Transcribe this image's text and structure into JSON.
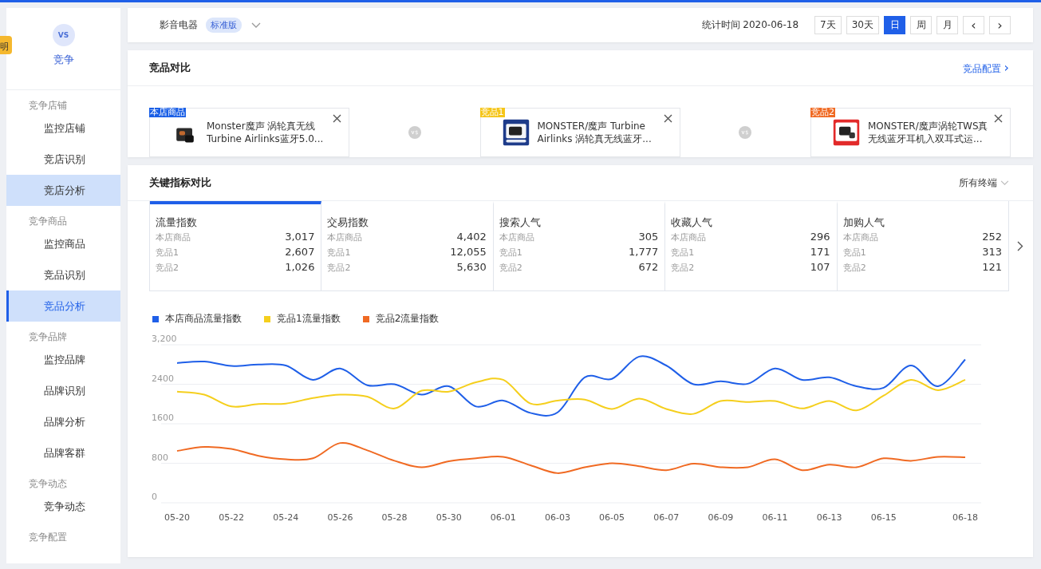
{
  "help_badge": {
    "label": "明"
  },
  "sidebar": {
    "header": {
      "label": "竞争",
      "icon_text": "VS"
    },
    "groups": [
      {
        "title": "竞争店铺",
        "items": [
          {
            "label": "监控店铺",
            "selected": false,
            "hovered": false
          },
          {
            "label": "竞店识别",
            "selected": false,
            "hovered": false
          },
          {
            "label": "竞店分析",
            "selected": false,
            "hovered": true
          }
        ]
      },
      {
        "title": "竞争商品",
        "items": [
          {
            "label": "监控商品",
            "selected": false,
            "hovered": false
          },
          {
            "label": "竞品识别",
            "selected": false,
            "hovered": false
          },
          {
            "label": "竞品分析",
            "selected": true,
            "hovered": false
          }
        ]
      },
      {
        "title": "竞争品牌",
        "items": [
          {
            "label": "监控品牌",
            "selected": false,
            "hovered": false
          },
          {
            "label": "品牌识别",
            "selected": false,
            "hovered": false
          },
          {
            "label": "品牌分析",
            "selected": false,
            "hovered": false
          },
          {
            "label": "品牌客群",
            "selected": false,
            "hovered": false
          }
        ]
      },
      {
        "title": "竞争动态",
        "items": [
          {
            "label": "竞争动态",
            "selected": false,
            "hovered": false
          }
        ]
      },
      {
        "title": "竞争配置"
      }
    ]
  },
  "top_bar": {
    "category": "影音电器",
    "edition": "标准版",
    "stat_time": "统计时间 2020-06-18",
    "periods": [
      {
        "label": "7天",
        "selected": false
      },
      {
        "label": "30天",
        "selected": false
      },
      {
        "label": "日",
        "selected": true
      },
      {
        "label": "周",
        "selected": false
      },
      {
        "label": "月",
        "selected": false
      }
    ],
    "prev": "‹",
    "next": "›"
  },
  "comparison": {
    "title": "竞品对比",
    "config_link": "竞品配置",
    "config_arrow": "›",
    "products": [
      {
        "tag": "本店商品",
        "color": "#1a5fe6",
        "name": "Monster魔声 涡轮真无线Turbine Airlinks蓝牙5.0...",
        "kind": "picture"
      },
      {
        "tag": "竞品1",
        "color": "#f5c518",
        "name": "MONSTER/魔声 Turbine Airlinks 涡轮真无线蓝牙...",
        "kind": "picture"
      },
      {
        "tag": "竞品2",
        "color": "#f06a23",
        "name": "MONSTER/魔声涡轮TWS真无线蓝牙耳机入双耳式运...",
        "kind": "picture"
      }
    ]
  },
  "metrics": {
    "title": "关键指标对比",
    "terminal": "所有终端",
    "cards": [
      {
        "title": "流量指数",
        "selected": true,
        "rows": [
          {
            "label": "本店商品",
            "value": "3,017"
          },
          {
            "label": "竞品1",
            "value": "2,607"
          },
          {
            "label": "竞品2",
            "value": "1,026"
          }
        ]
      },
      {
        "title": "交易指数",
        "selected": false,
        "rows": [
          {
            "label": "本店商品",
            "value": "4,402"
          },
          {
            "label": "竞品1",
            "value": "12,055"
          },
          {
            "label": "竞品2",
            "value": "5,630"
          }
        ]
      },
      {
        "title": "搜索人气",
        "selected": false,
        "rows": [
          {
            "label": "本店商品",
            "value": "305"
          },
          {
            "label": "竞品1",
            "value": "1,777"
          },
          {
            "label": "竞品2",
            "value": "672"
          }
        ]
      },
      {
        "title": "收藏人气",
        "selected": false,
        "rows": [
          {
            "label": "本店商品",
            "value": "296"
          },
          {
            "label": "竞品1",
            "value": "171"
          },
          {
            "label": "竞品2",
            "value": "107"
          }
        ]
      },
      {
        "title": "加购人气",
        "selected": false,
        "rows": [
          {
            "label": "本店商品",
            "value": "252"
          },
          {
            "label": "竞品1",
            "value": "313"
          },
          {
            "label": "竞品2",
            "value": "121"
          }
        ]
      }
    ],
    "chart_data": {
      "type": "line",
      "grid": true,
      "categories": [
        "05-20",
        null,
        "05-22",
        null,
        "05-24",
        null,
        "05-26",
        null,
        "05-28",
        null,
        "05-30",
        null,
        "06-01",
        null,
        "06-03",
        null,
        "06-05",
        null,
        "06-07",
        null,
        "06-09",
        null,
        "06-11",
        null,
        "06-13",
        null,
        "06-15",
        null,
        null,
        "06-18"
      ],
      "series": [
        {
          "name": "本店商品流量指数",
          "color": "#1f5fe8",
          "values": [
            2830,
            2860,
            2770,
            2800,
            2780,
            2490,
            2720,
            2380,
            2400,
            2190,
            2360,
            1950,
            2070,
            1820,
            1830,
            2540,
            2510,
            2960,
            2780,
            2400,
            2460,
            2410,
            2720,
            2490,
            2540,
            2360,
            2330,
            2780,
            2360,
            2900
          ]
        },
        {
          "name": "竞品1流量指数",
          "color": "#f5cf1d",
          "values": [
            2250,
            2190,
            1950,
            2000,
            2010,
            2120,
            2190,
            2150,
            1910,
            2270,
            2250,
            2440,
            2490,
            2010,
            2070,
            2090,
            1900,
            2110,
            1900,
            1800,
            2060,
            2040,
            2060,
            1910,
            2060,
            1870,
            2170,
            2490,
            2280,
            2490
          ]
        },
        {
          "name": "竞品2流量指数",
          "color": "#f06a23",
          "values": [
            1050,
            1130,
            1090,
            950,
            880,
            900,
            1210,
            1060,
            850,
            720,
            840,
            900,
            930,
            760,
            600,
            720,
            800,
            740,
            660,
            790,
            720,
            720,
            880,
            660,
            770,
            720,
            900,
            850,
            930,
            920
          ]
        }
      ],
      "ylim": [
        0,
        3200
      ],
      "yticks": [
        0,
        800,
        1600,
        2400,
        {
          "value": 3200,
          "label": "3,200"
        }
      ]
    }
  }
}
